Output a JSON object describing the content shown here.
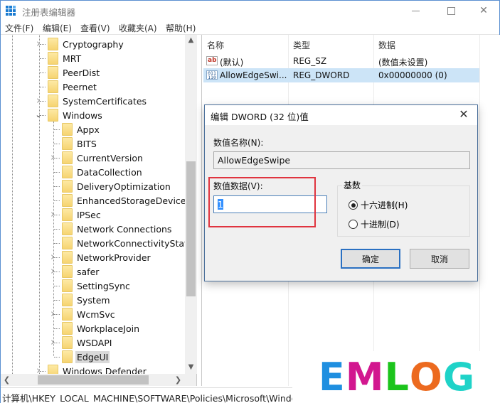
{
  "window": {
    "title": "注册表编辑器",
    "controls": {
      "minimize": "—",
      "maximize": "□",
      "close": "✕"
    }
  },
  "menu": [
    {
      "label": "文件(F)"
    },
    {
      "label": "编辑(E)"
    },
    {
      "label": "查看(V)"
    },
    {
      "label": "收藏夹(A)"
    },
    {
      "label": "帮助(H)"
    }
  ],
  "tree": {
    "items": [
      {
        "label": "Cryptography",
        "level": 2,
        "expander": "collapsed"
      },
      {
        "label": "MRT",
        "level": 2,
        "expander": "none"
      },
      {
        "label": "PeerDist",
        "level": 2,
        "expander": "none"
      },
      {
        "label": "Peernet",
        "level": 2,
        "expander": "none"
      },
      {
        "label": "SystemCertificates",
        "level": 2,
        "expander": "collapsed"
      },
      {
        "label": "Windows",
        "level": 2,
        "expander": "expanded"
      },
      {
        "label": "Appx",
        "level": 3,
        "expander": "none"
      },
      {
        "label": "BITS",
        "level": 3,
        "expander": "none"
      },
      {
        "label": "CurrentVersion",
        "level": 3,
        "expander": "collapsed"
      },
      {
        "label": "DataCollection",
        "level": 3,
        "expander": "none"
      },
      {
        "label": "DeliveryOptimization",
        "level": 3,
        "expander": "none"
      },
      {
        "label": "EnhancedStorageDevices",
        "level": 3,
        "expander": "none"
      },
      {
        "label": "IPSec",
        "level": 3,
        "expander": "collapsed"
      },
      {
        "label": "Network Connections",
        "level": 3,
        "expander": "none"
      },
      {
        "label": "NetworkConnectivityStatus",
        "level": 3,
        "expander": "none"
      },
      {
        "label": "NetworkProvider",
        "level": 3,
        "expander": "collapsed"
      },
      {
        "label": "safer",
        "level": 3,
        "expander": "collapsed"
      },
      {
        "label": "SettingSync",
        "level": 3,
        "expander": "none"
      },
      {
        "label": "System",
        "level": 3,
        "expander": "none"
      },
      {
        "label": "WcmSvc",
        "level": 3,
        "expander": "collapsed"
      },
      {
        "label": "WorkplaceJoin",
        "level": 3,
        "expander": "none"
      },
      {
        "label": "WSDAPI",
        "level": 3,
        "expander": "collapsed"
      },
      {
        "label": "EdgeUI",
        "level": 3,
        "expander": "none",
        "selected": true
      },
      {
        "label": "Windows Defender",
        "level": 2,
        "expander": "collapsed"
      }
    ],
    "scroll_up": "^",
    "scroll_down": "v",
    "scroll_left": "<",
    "scroll_right": ">"
  },
  "list": {
    "headers": {
      "name": "名称",
      "type": "类型",
      "data": "数据"
    },
    "rows": [
      {
        "icon": "string-value-icon",
        "icon_text": "ab",
        "name": "(默认)",
        "type": "REG_SZ",
        "data": "(数值未设置)"
      },
      {
        "icon": "binary-value-icon",
        "icon_text": "011 110",
        "name": "AllowEdgeSwi...",
        "type": "REG_DWORD",
        "data": "0x00000000 (0)",
        "selected": true
      }
    ]
  },
  "status": {
    "path": "计算机\\HKEY_LOCAL_MACHINE\\SOFTWARE\\Policies\\Microsoft\\Windows\\EdgeUI"
  },
  "dialog": {
    "title": "编辑 DWORD (32 位)值",
    "close": "✕",
    "name_label": "数值名称(N):",
    "name_value": "AllowEdgeSwipe",
    "data_label": "数值数据(V):",
    "data_value": "1",
    "base_label": "基数",
    "radios": [
      {
        "label": "十六进制(H)",
        "checked": true
      },
      {
        "label": "十进制(D)",
        "checked": false
      }
    ],
    "ok": "确定",
    "cancel": "取消"
  },
  "watermark": {
    "letters": [
      {
        "char": "E",
        "color": "#1f8fe0"
      },
      {
        "char": "M",
        "color": "#d2178f"
      },
      {
        "char": "L",
        "color": "#1cc41c"
      },
      {
        "char": "O",
        "color": "#ec6a1f"
      },
      {
        "char": "G",
        "color": "#1fd3c8"
      }
    ]
  },
  "colors": {
    "accent": "#2a70c2",
    "selection": "#cce4f7",
    "highlight_box": "#e0343f"
  }
}
